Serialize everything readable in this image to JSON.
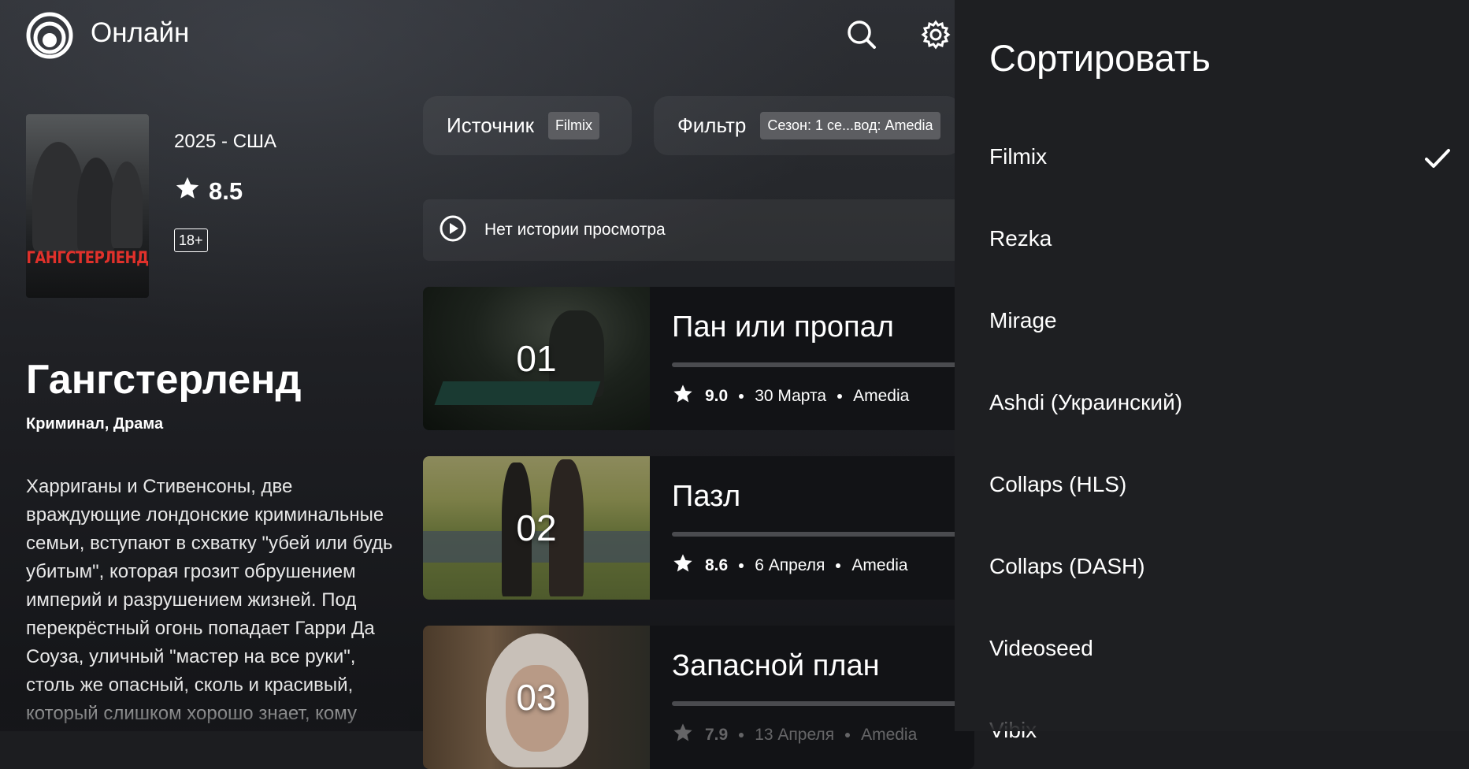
{
  "header": {
    "app_title": "Онлайн",
    "logo_icon": "logo-rings-icon",
    "search_icon": "search-icon",
    "settings_icon": "gear-icon"
  },
  "movie": {
    "poster_title": "ГАНГСТЕРЛЕНД",
    "year_country": "2025 - США",
    "rating": "8.5",
    "age": "18+",
    "title": "Гангстерленд",
    "genres": "Криминал, Драма",
    "description": "Харриганы и Стивенсоны, две враждующие лондонские криминальные семьи, вступают в схватку \"убей или будь убитым\", которая грозит обрушением империй и разрушением жизней. Под перекрёстный огонь попадает Гарри Да Соуза, уличный \"мастер на все руки\", столь же опасный, сколь и красивый, который слишком хорошо знает, кому"
  },
  "controls": {
    "source_label": "Источник",
    "source_value": "Filmix",
    "filter_label": "Фильтр",
    "filter_value": "Сезон: 1 се...вод: Amedia",
    "history_text": "Нет истории просмотра"
  },
  "episodes": [
    {
      "number": "01",
      "title": "Пан или пропал",
      "score": "9.0",
      "date": "30 Марта",
      "voice": "Amedia"
    },
    {
      "number": "02",
      "title": "Пазл",
      "score": "8.6",
      "date": "6 Апреля",
      "voice": "Amedia"
    },
    {
      "number": "03",
      "title": "Запасной план",
      "score": "7.9",
      "date": "13 Апреля",
      "voice": "Amedia"
    }
  ],
  "sort_panel": {
    "title": "Сортировать",
    "selected": "Filmix",
    "options": [
      "Filmix",
      "Rezka",
      "Mirage",
      "Ashdi (Украинский)",
      "Collaps (HLS)",
      "Collaps (DASH)",
      "Videoseed",
      "Vibix"
    ]
  },
  "colors": {
    "panel_bg": "#1e1f22",
    "badge_bg": "#5c5d61",
    "poster_title": "#e0312b"
  }
}
